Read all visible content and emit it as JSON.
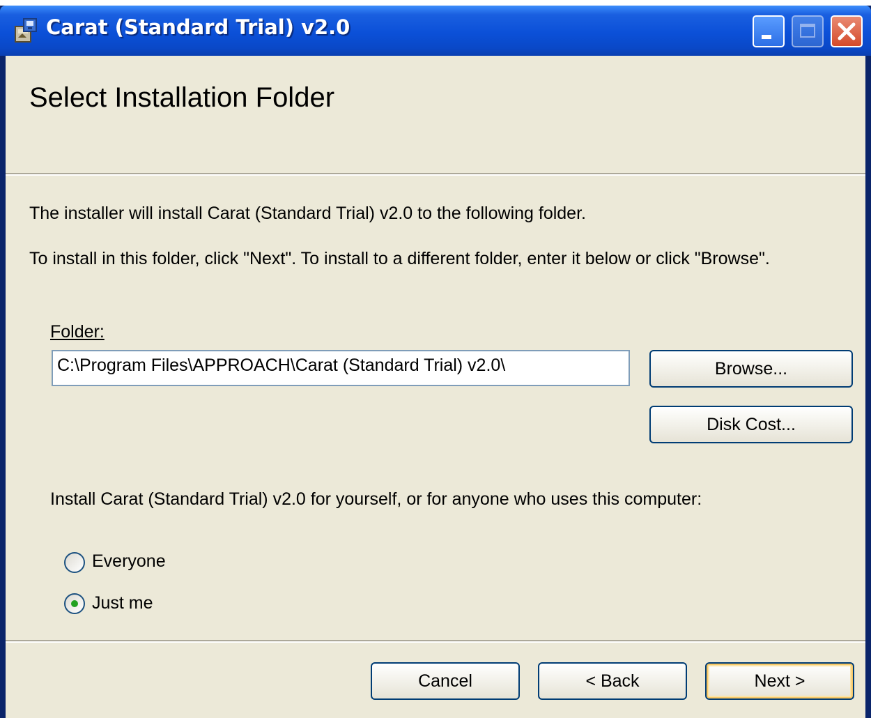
{
  "window": {
    "title": "Carat (Standard Trial) v2.0"
  },
  "header": {
    "title": "Select Installation Folder"
  },
  "body": {
    "line1": "The installer will install Carat (Standard Trial) v2.0 to the following folder.",
    "line2": "To install in this folder, click \"Next\". To install to a different folder, enter it below or click \"Browse\"."
  },
  "folder": {
    "label": "Folder:",
    "value": "C:\\Program Files\\APPROACH\\Carat (Standard Trial) v2.0\\"
  },
  "buttons": {
    "browse": "Browse...",
    "disk_cost": "Disk Cost...",
    "cancel": "Cancel",
    "back": "< Back",
    "next": "Next >"
  },
  "install_for": {
    "label": "Install Carat (Standard Trial) v2.0 for yourself, or for anyone who uses this computer:",
    "options": [
      {
        "label": "Everyone",
        "selected": false
      },
      {
        "label": "Just me",
        "selected": true
      }
    ]
  },
  "colors": {
    "titlebar": "#0b50d8",
    "dialog_bg": "#ece9d8",
    "button_border": "#003c74",
    "close_button": "#d44a2a",
    "radio_dot": "#21a121"
  },
  "icons": {
    "title": "installer-package-icon",
    "minimize": "minimize-icon",
    "maximize": "maximize-icon",
    "close": "close-icon"
  }
}
